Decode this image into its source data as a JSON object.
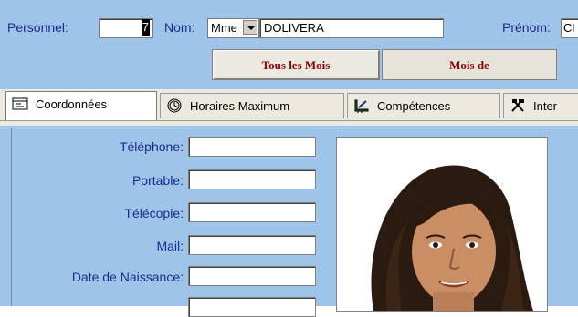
{
  "header": {
    "personnel_label": "Personnel:",
    "personnel_value": "7",
    "nom_label": "Nom:",
    "civilite": "Mme",
    "nom_value": "DOLIVERA",
    "prenom_label": "Prénom:",
    "prenom_value": "Cl"
  },
  "months": {
    "all_label": "Tous les Mois",
    "month_label": "Mois de"
  },
  "tabs": [
    {
      "label": "Coordonnées",
      "icon": "card-icon"
    },
    {
      "label": "Horaires Maximum",
      "icon": "clock-icon"
    },
    {
      "label": "Compétences",
      "icon": "ruler-icon"
    },
    {
      "label": "Inter",
      "icon": "tools-icon"
    }
  ],
  "form": {
    "telephone_label": "Téléphone:",
    "portable_label": "Portable:",
    "telecopie_label": "Télécopie:",
    "mail_label": "Mail:",
    "naissance_label": "Date de Naissance:"
  },
  "photo": {
    "icon": "person-photo"
  }
}
